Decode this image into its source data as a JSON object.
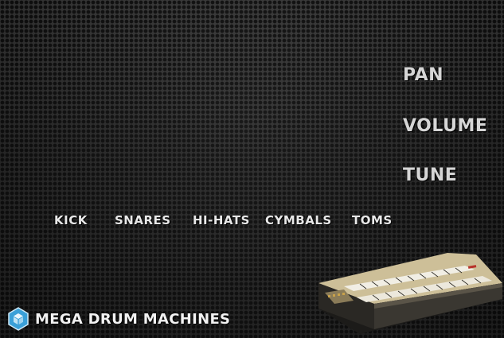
{
  "controls": {
    "pan": "PAN",
    "volume": "VOLUME",
    "tune": "TUNE"
  },
  "drums": {
    "kick": "KICK",
    "snares": "SNARES",
    "hihats": "HI-HATS",
    "cymbals": "CYMBALS",
    "toms": "TOMS"
  },
  "brand": {
    "name": "MEGA DRUM MACHINES",
    "icon": "cube-icon"
  },
  "colors": {
    "accent": "#3aa0d8",
    "text": "#e9e9e9"
  }
}
